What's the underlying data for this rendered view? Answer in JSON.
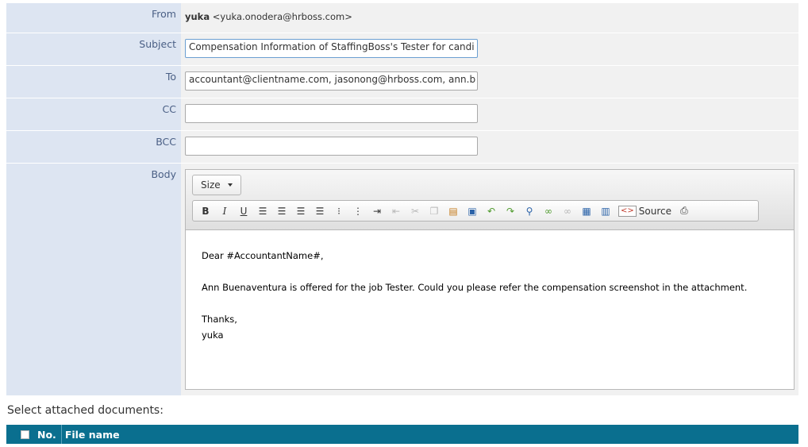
{
  "form": {
    "from_label": "From",
    "from_name": "yuka",
    "from_email": "<yuka.onodera@hrboss.com>",
    "subject_label": "Subject",
    "subject_value": "Compensation Information of StaffingBoss's Tester for candi",
    "to_label": "To",
    "to_value": "accountant@clientname.com, jasonong@hrboss.com, ann.b",
    "cc_label": "CC",
    "cc_value": "",
    "bcc_label": "BCC",
    "bcc_value": "",
    "body_label": "Body"
  },
  "editor": {
    "size_label": "Size",
    "toolbar": {
      "bold": "B",
      "italic": "I",
      "underline": "U",
      "source_label": "Source"
    },
    "content": {
      "line1": "Dear #AccountantName#,",
      "line2": "Ann Buenaventura is offered for the job Tester. Could you please refer the compensation screenshot in the attachment.",
      "line3": "Thanks,",
      "line4": "yuka"
    }
  },
  "attachments": {
    "label": "Select attached documents:",
    "columns": {
      "no": "No.",
      "file_name": "File name"
    }
  }
}
